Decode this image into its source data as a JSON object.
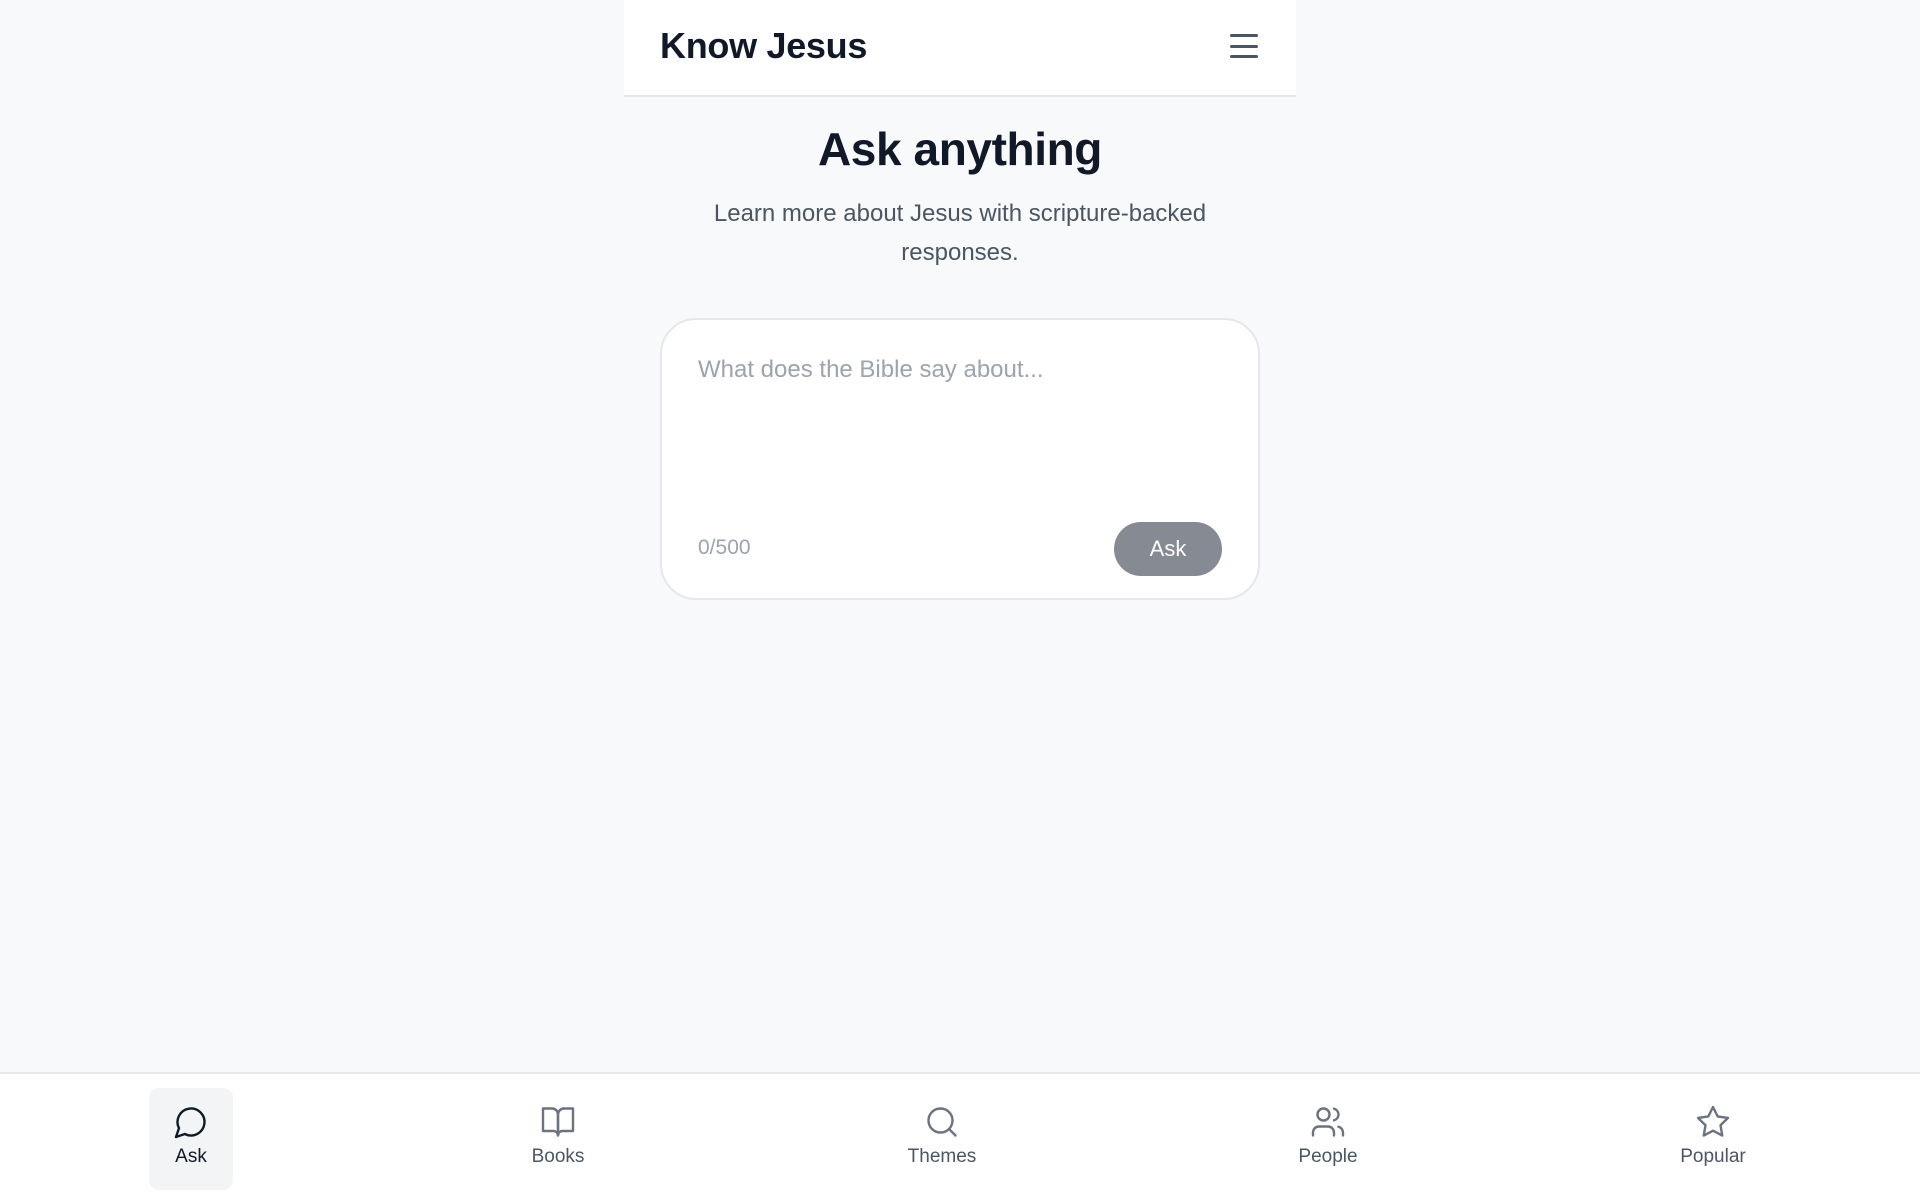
{
  "header": {
    "title": "Know Jesus",
    "menu_icon": "hamburger-menu-icon"
  },
  "hero": {
    "title": "Ask anything",
    "subtitle": "Learn more about Jesus with scripture-backed responses."
  },
  "ask_form": {
    "value": "",
    "placeholder": "What does the Bible say about...",
    "char_count": "0/500",
    "submit_label": "Ask"
  },
  "bottom_nav": {
    "active": "Ask",
    "items": [
      {
        "label": "Ask",
        "icon": "chat-bubble-icon"
      },
      {
        "label": "Books",
        "icon": "open-book-icon"
      },
      {
        "label": "Themes",
        "icon": "search-icon"
      },
      {
        "label": "People",
        "icon": "people-icon"
      },
      {
        "label": "Popular",
        "icon": "star-icon"
      }
    ]
  },
  "colors": {
    "background": "#f8f9fb",
    "surface": "#ffffff",
    "text_primary": "#111827",
    "text_secondary": "#4b5563",
    "muted": "#9ca3af",
    "button_disabled": "#868a93",
    "active_nav_bg": "#f3f4f6",
    "border": "#e5e7eb"
  }
}
